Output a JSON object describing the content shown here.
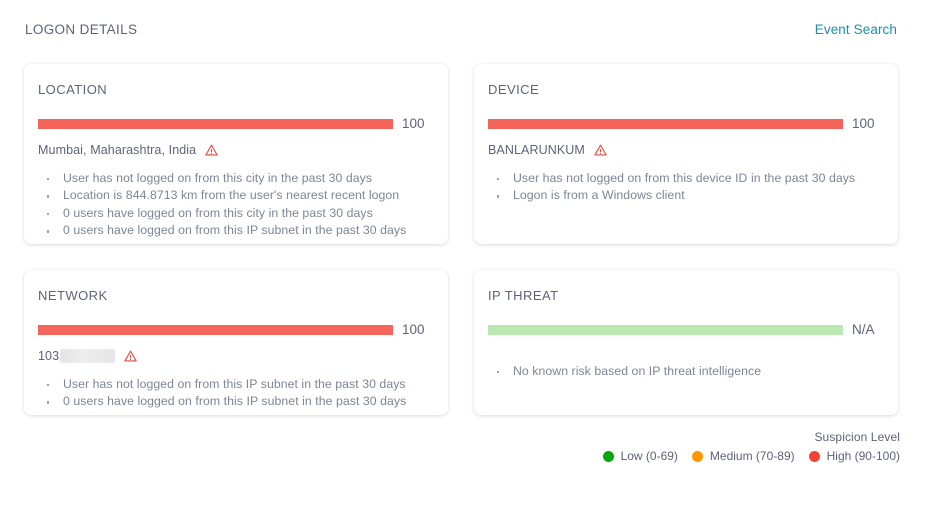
{
  "header": {
    "title": "LOGON DETAILS",
    "event_search_label": "Event Search",
    "link_color": "#1f8fa8"
  },
  "colors": {
    "high": "#f4645a",
    "na": "#bae7b2",
    "legend_low": "#00a80a",
    "legend_medium": "#ff9800",
    "legend_high": "#f44336",
    "warning": "#e8453c"
  },
  "cards": [
    {
      "title": "LOCATION",
      "score": "100",
      "severity": "high",
      "bar_percent": 100,
      "subject": "Mumbai, Maharashtra, India",
      "redacted": false,
      "warning_icon": "warning-triangle-icon",
      "reasons": [
        "User has not logged on from this city in the past 30 days",
        "Location is 844.8713 km from the user's nearest recent logon",
        "0 users have logged on from this city in the past 30 days",
        "0 users have logged on from this IP subnet in the past 30 days"
      ]
    },
    {
      "title": "DEVICE",
      "score": "100",
      "severity": "high",
      "bar_percent": 100,
      "subject": "BANLARUNKUM",
      "redacted": false,
      "warning_icon": "warning-triangle-icon",
      "reasons": [
        "User has not logged on from this device ID in the past 30 days",
        "Logon is from a Windows client"
      ]
    },
    {
      "title": "NETWORK",
      "score": "100",
      "severity": "high",
      "bar_percent": 100,
      "subject": "103",
      "redacted": true,
      "warning_icon": "warning-triangle-icon",
      "reasons": [
        "User has not logged on from this IP subnet in the past 30 days",
        "0 users have logged on from this IP subnet in the past 30 days"
      ]
    },
    {
      "title": "IP THREAT",
      "score": "N/A",
      "severity": "na",
      "bar_percent": 100,
      "subject": "",
      "redacted": false,
      "warning_icon": null,
      "reasons": [
        "No known risk based on IP threat intelligence"
      ]
    }
  ],
  "legend": {
    "caption": "Suspicion Level",
    "items": [
      {
        "label": "Low (0-69)",
        "color": "#00a80a"
      },
      {
        "label": "Medium (70-89)",
        "color": "#ff9800"
      },
      {
        "label": "High (90-100)",
        "color": "#f44336"
      }
    ]
  }
}
